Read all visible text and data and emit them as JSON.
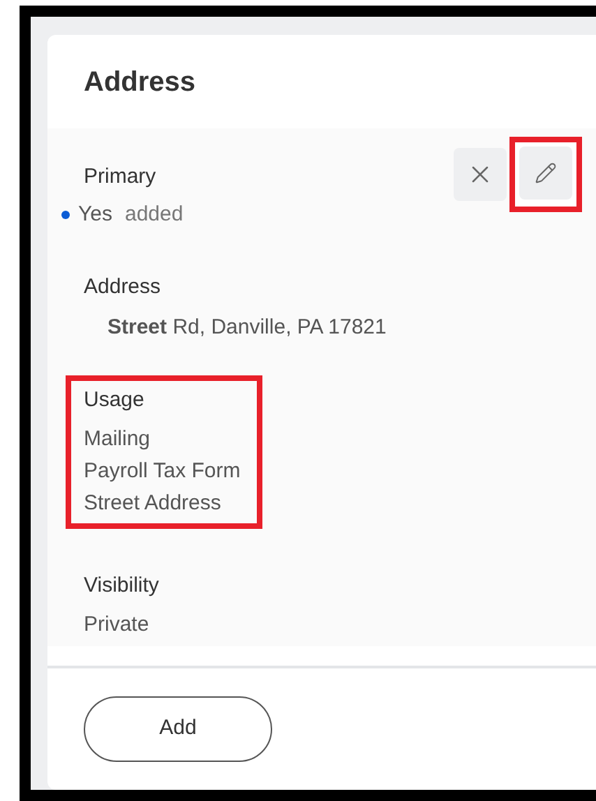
{
  "card": {
    "title": "Address"
  },
  "actions": [
    {
      "kind": "remove",
      "highlighted": false
    },
    {
      "kind": "edit",
      "highlighted": true
    }
  ],
  "fields": [
    {
      "label": "Primary",
      "kind": "status",
      "value": "Yes",
      "change": "added",
      "highlighted": false
    },
    {
      "label": "Address",
      "kind": "address",
      "lines": [
        "**Street** Rd, Danville, PA 17821"
      ],
      "highlighted": false
    },
    {
      "label": "Usage",
      "kind": "list",
      "lines": [
        "Mailing",
        "Payroll Tax Form",
        "Street Address"
      ],
      "highlighted": true
    },
    {
      "label": "Visibility",
      "kind": "list",
      "lines": [
        "Private"
      ],
      "highlighted": false
    }
  ],
  "footer": {
    "button": "Add"
  }
}
